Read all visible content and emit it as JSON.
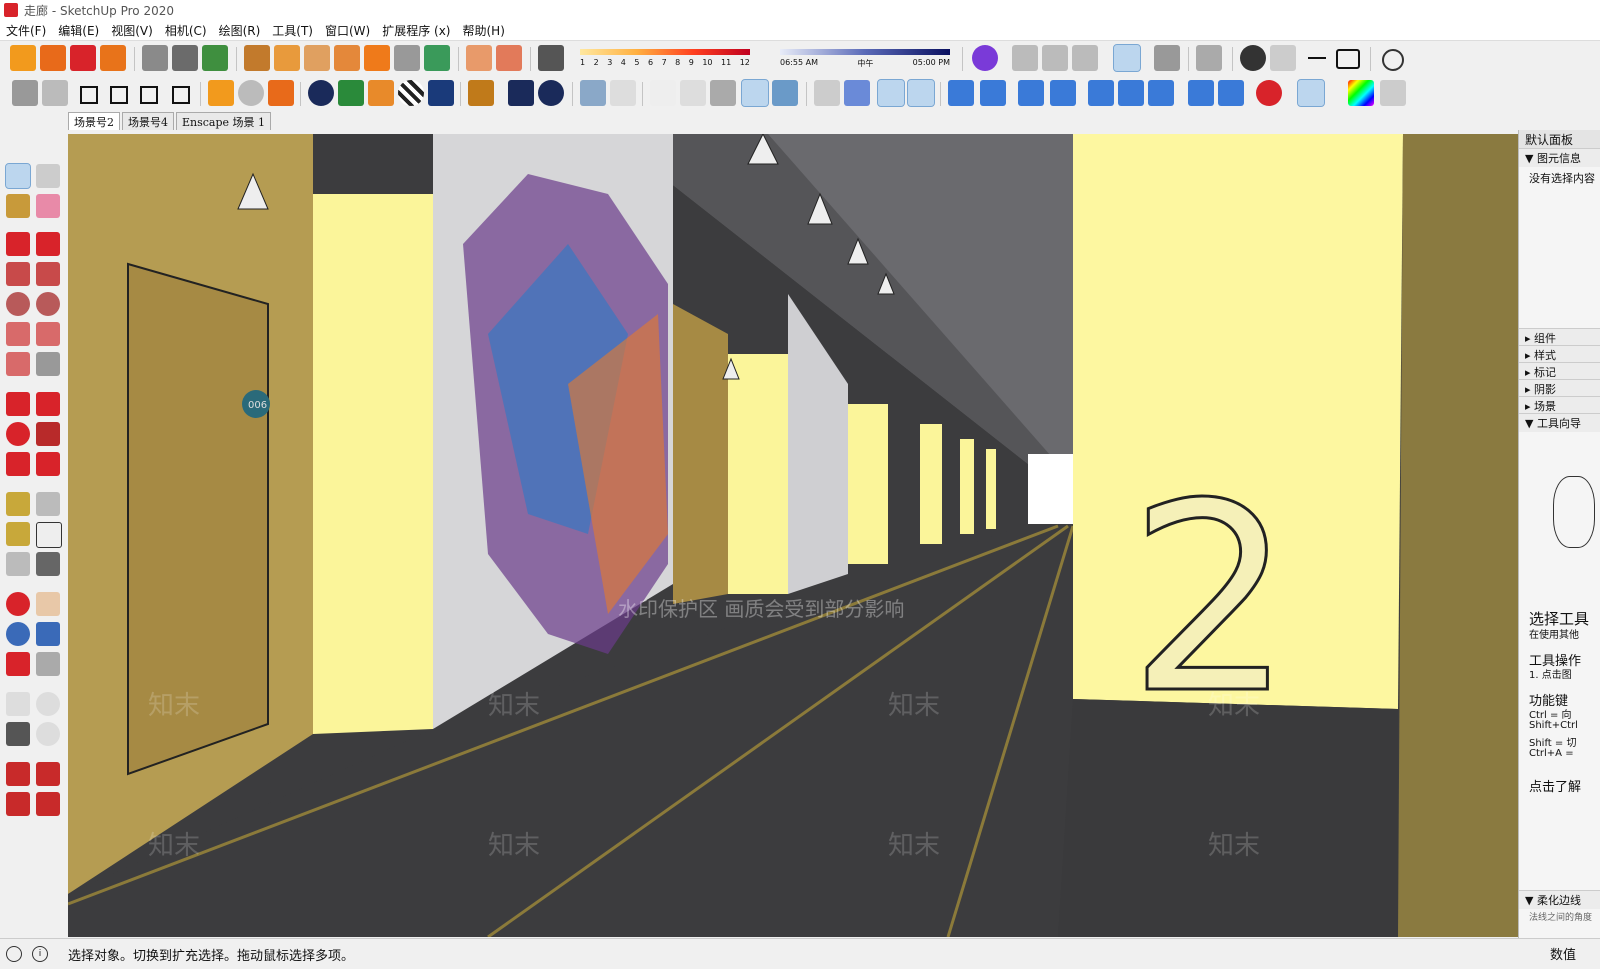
{
  "window": {
    "title": "走廊 - SketchUp Pro 2020"
  },
  "menu": [
    "文件(F)",
    "编辑(E)",
    "视图(V)",
    "相机(C)",
    "绘图(R)",
    "工具(T)",
    "窗口(W)",
    "扩展程序 (x)",
    "帮助(H)"
  ],
  "shadow_slider": {
    "months": [
      "1",
      "2",
      "3",
      "4",
      "5",
      "6",
      "7",
      "8",
      "9",
      "10",
      "11",
      "12"
    ],
    "time_start": "06:55 AM",
    "time_mid": "中午",
    "time_end": "05:00 PM"
  },
  "scenes": [
    {
      "label": "场景号2",
      "active": true
    },
    {
      "label": "场景号4",
      "active": false
    },
    {
      "label": "Enscape 场景 1",
      "active": false
    }
  ],
  "panel": {
    "title": "默认面板",
    "entity_info": "图元信息",
    "no_selection": "没有选择内容",
    "sections": [
      "组件",
      "样式",
      "标记",
      "阴影",
      "场景",
      "工具向导"
    ],
    "instructor_title": "选择工具",
    "instructor_sub": "在使用其他",
    "ops_title": "工具操作",
    "ops_1": "1. 点击图",
    "keys_title": "功能键",
    "key_1": "Ctrl = 向",
    "key_2": "Shift+Ctrl",
    "key_3": "Shift = 切",
    "key_4": "Ctrl+A = ",
    "more": "点击了解",
    "soften": "柔化边线",
    "soften_sub": "法线之间的角度"
  },
  "viewport": {
    "watermark_banner": "水印保护区   画质会受到部分影响",
    "watermark_logo": "知末",
    "number_sign": "2",
    "door_number": "006"
  },
  "status": {
    "hint": "选择对象。切换到扩充选择。拖动鼠标选择多项。",
    "measure_label": "数值"
  },
  "colors": {
    "wall_yellow": "#fdf7a0",
    "floor": "#3c3c3e",
    "stripe": "#8b7a3a",
    "accent": "#d8232a"
  }
}
